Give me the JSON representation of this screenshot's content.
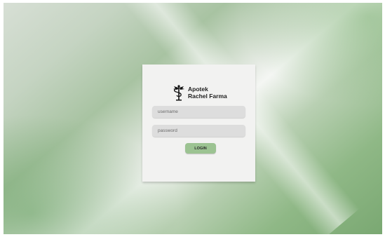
{
  "brand": {
    "line1": "Apotek",
    "line2": "Rachel Farma",
    "logo_icon": "caduceus-pharmacy-icon"
  },
  "login_form": {
    "username_placeholder": "username",
    "username_value": "",
    "password_placeholder": "password",
    "password_value": "",
    "login_label": "LOGIN"
  },
  "colors": {
    "card_background": "#f2f2f1",
    "field_background": "#dddddd",
    "login_button": "#9cc392",
    "background_green": "#8fb886"
  }
}
